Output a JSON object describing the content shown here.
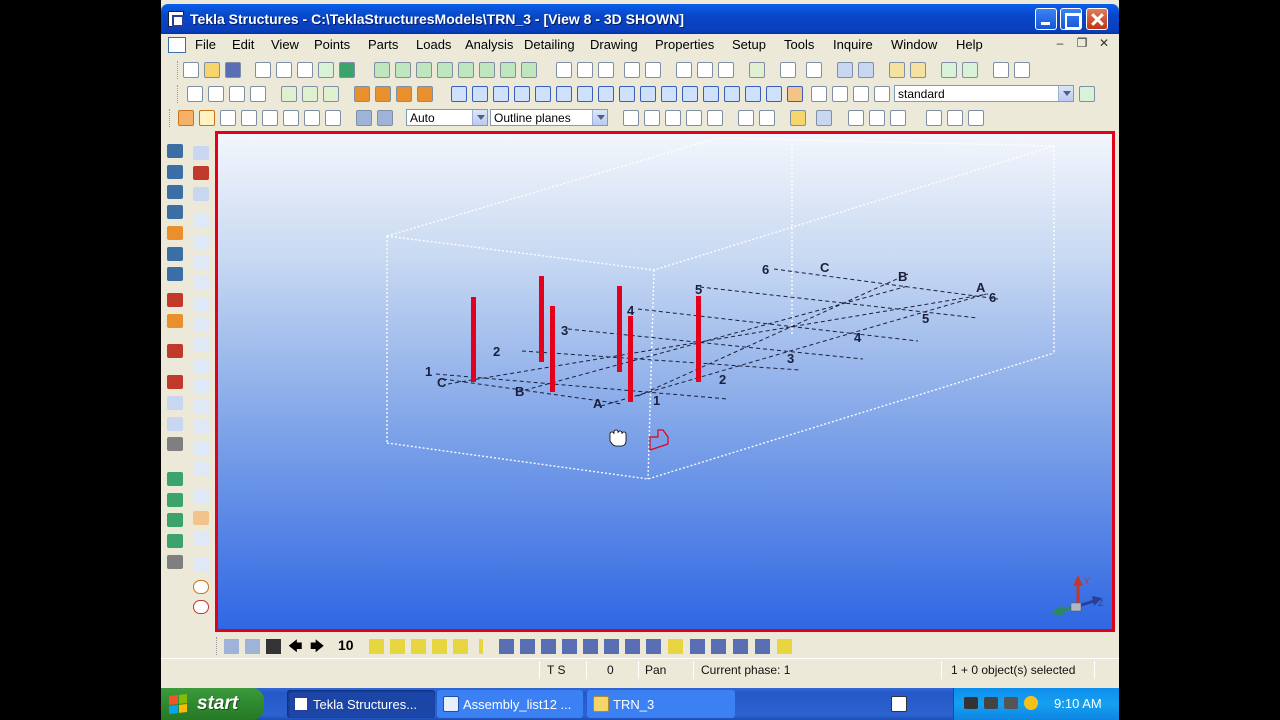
{
  "window": {
    "title": "Tekla Structures - C:\\TeklaStructuresModels\\TRN_3 - [View 8 - 3D SHOWN]"
  },
  "menu": [
    "File",
    "Edit",
    "View",
    "Points",
    "Parts",
    "Loads",
    "Analysis",
    "Detailing",
    "Drawing",
    "Properties",
    "Setup",
    "Tools",
    "Inquire",
    "Window",
    "Help"
  ],
  "toolbar": {
    "filter_combo": "standard",
    "snap_combo_1": "Auto",
    "snap_combo_2": "Outline planes"
  },
  "bottom_toolbar": {
    "number_label": "10"
  },
  "grid_labels": {
    "front_numbers": [
      "1",
      "2",
      "3",
      "4",
      "5",
      "6"
    ],
    "front_letters": [
      "C",
      "B",
      "A"
    ],
    "back_numbers": [
      "1",
      "2",
      "3",
      "4",
      "5",
      "6"
    ],
    "back_letters": [
      "C",
      "B",
      "A"
    ]
  },
  "status": {
    "ts": "T S",
    "zero": "0",
    "mode": "Pan",
    "phase": "Current phase: 1",
    "selection": "1 + 0 object(s) selected"
  },
  "taskbar": {
    "start_label": "start",
    "tasks": [
      "Tekla Structures...",
      "Assembly_list12 ...",
      "TRN_3"
    ],
    "clock": "9:10 AM"
  },
  "axis": {
    "x": "X",
    "y": "Y",
    "z": "Z"
  },
  "colors": {
    "view_border": "#e3001b",
    "columns": "#e3001b",
    "grid": "#1a1f3c"
  }
}
